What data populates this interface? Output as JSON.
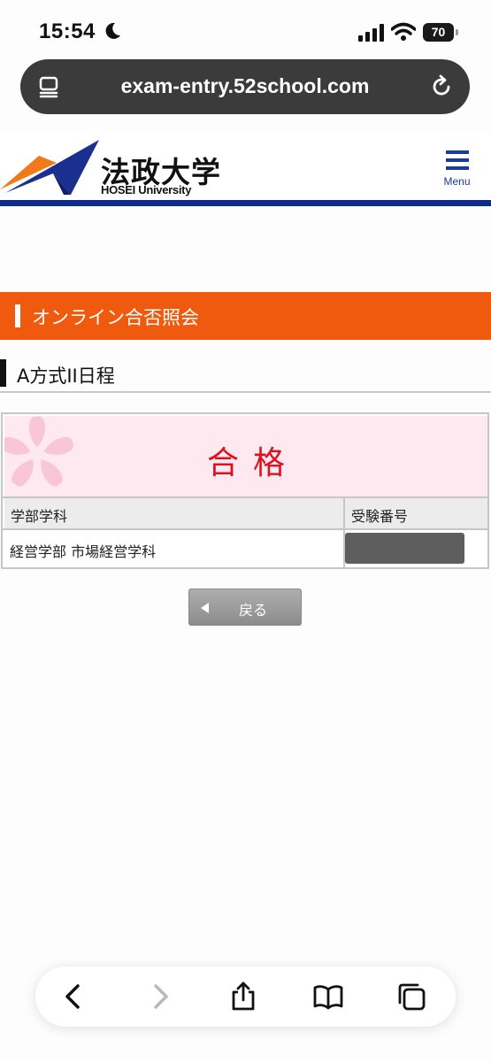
{
  "status_bar": {
    "time": "15:54",
    "battery": "70"
  },
  "browser": {
    "url": "exam-entry.52school.com"
  },
  "site": {
    "logo_kanji": "法政大学",
    "logo_en": "HOSEI University",
    "menu_label": "Menu"
  },
  "page": {
    "section_title": "オンライン合否照会",
    "schedule_title": "A方式II日程",
    "result": "合格",
    "table": {
      "headers": [
        "学部学科",
        "受験番号"
      ],
      "rows": [
        [
          "経営学部 市場経営学科",
          ""
        ]
      ]
    },
    "back_label": "戻る"
  },
  "colors": {
    "brand_orange": "#f05a0f",
    "brand_navy": "#0d2c8c",
    "result_red": "#e0101c",
    "banner_pink": "#fde9ef"
  },
  "icons": {
    "status": [
      "moon-icon",
      "signal-icon",
      "wifi-icon",
      "battery-icon"
    ],
    "url_bar": [
      "reader-icon",
      "reload-icon"
    ],
    "toolbar": [
      "back-icon",
      "forward-icon",
      "share-icon",
      "bookmarks-icon",
      "tabs-icon"
    ]
  }
}
